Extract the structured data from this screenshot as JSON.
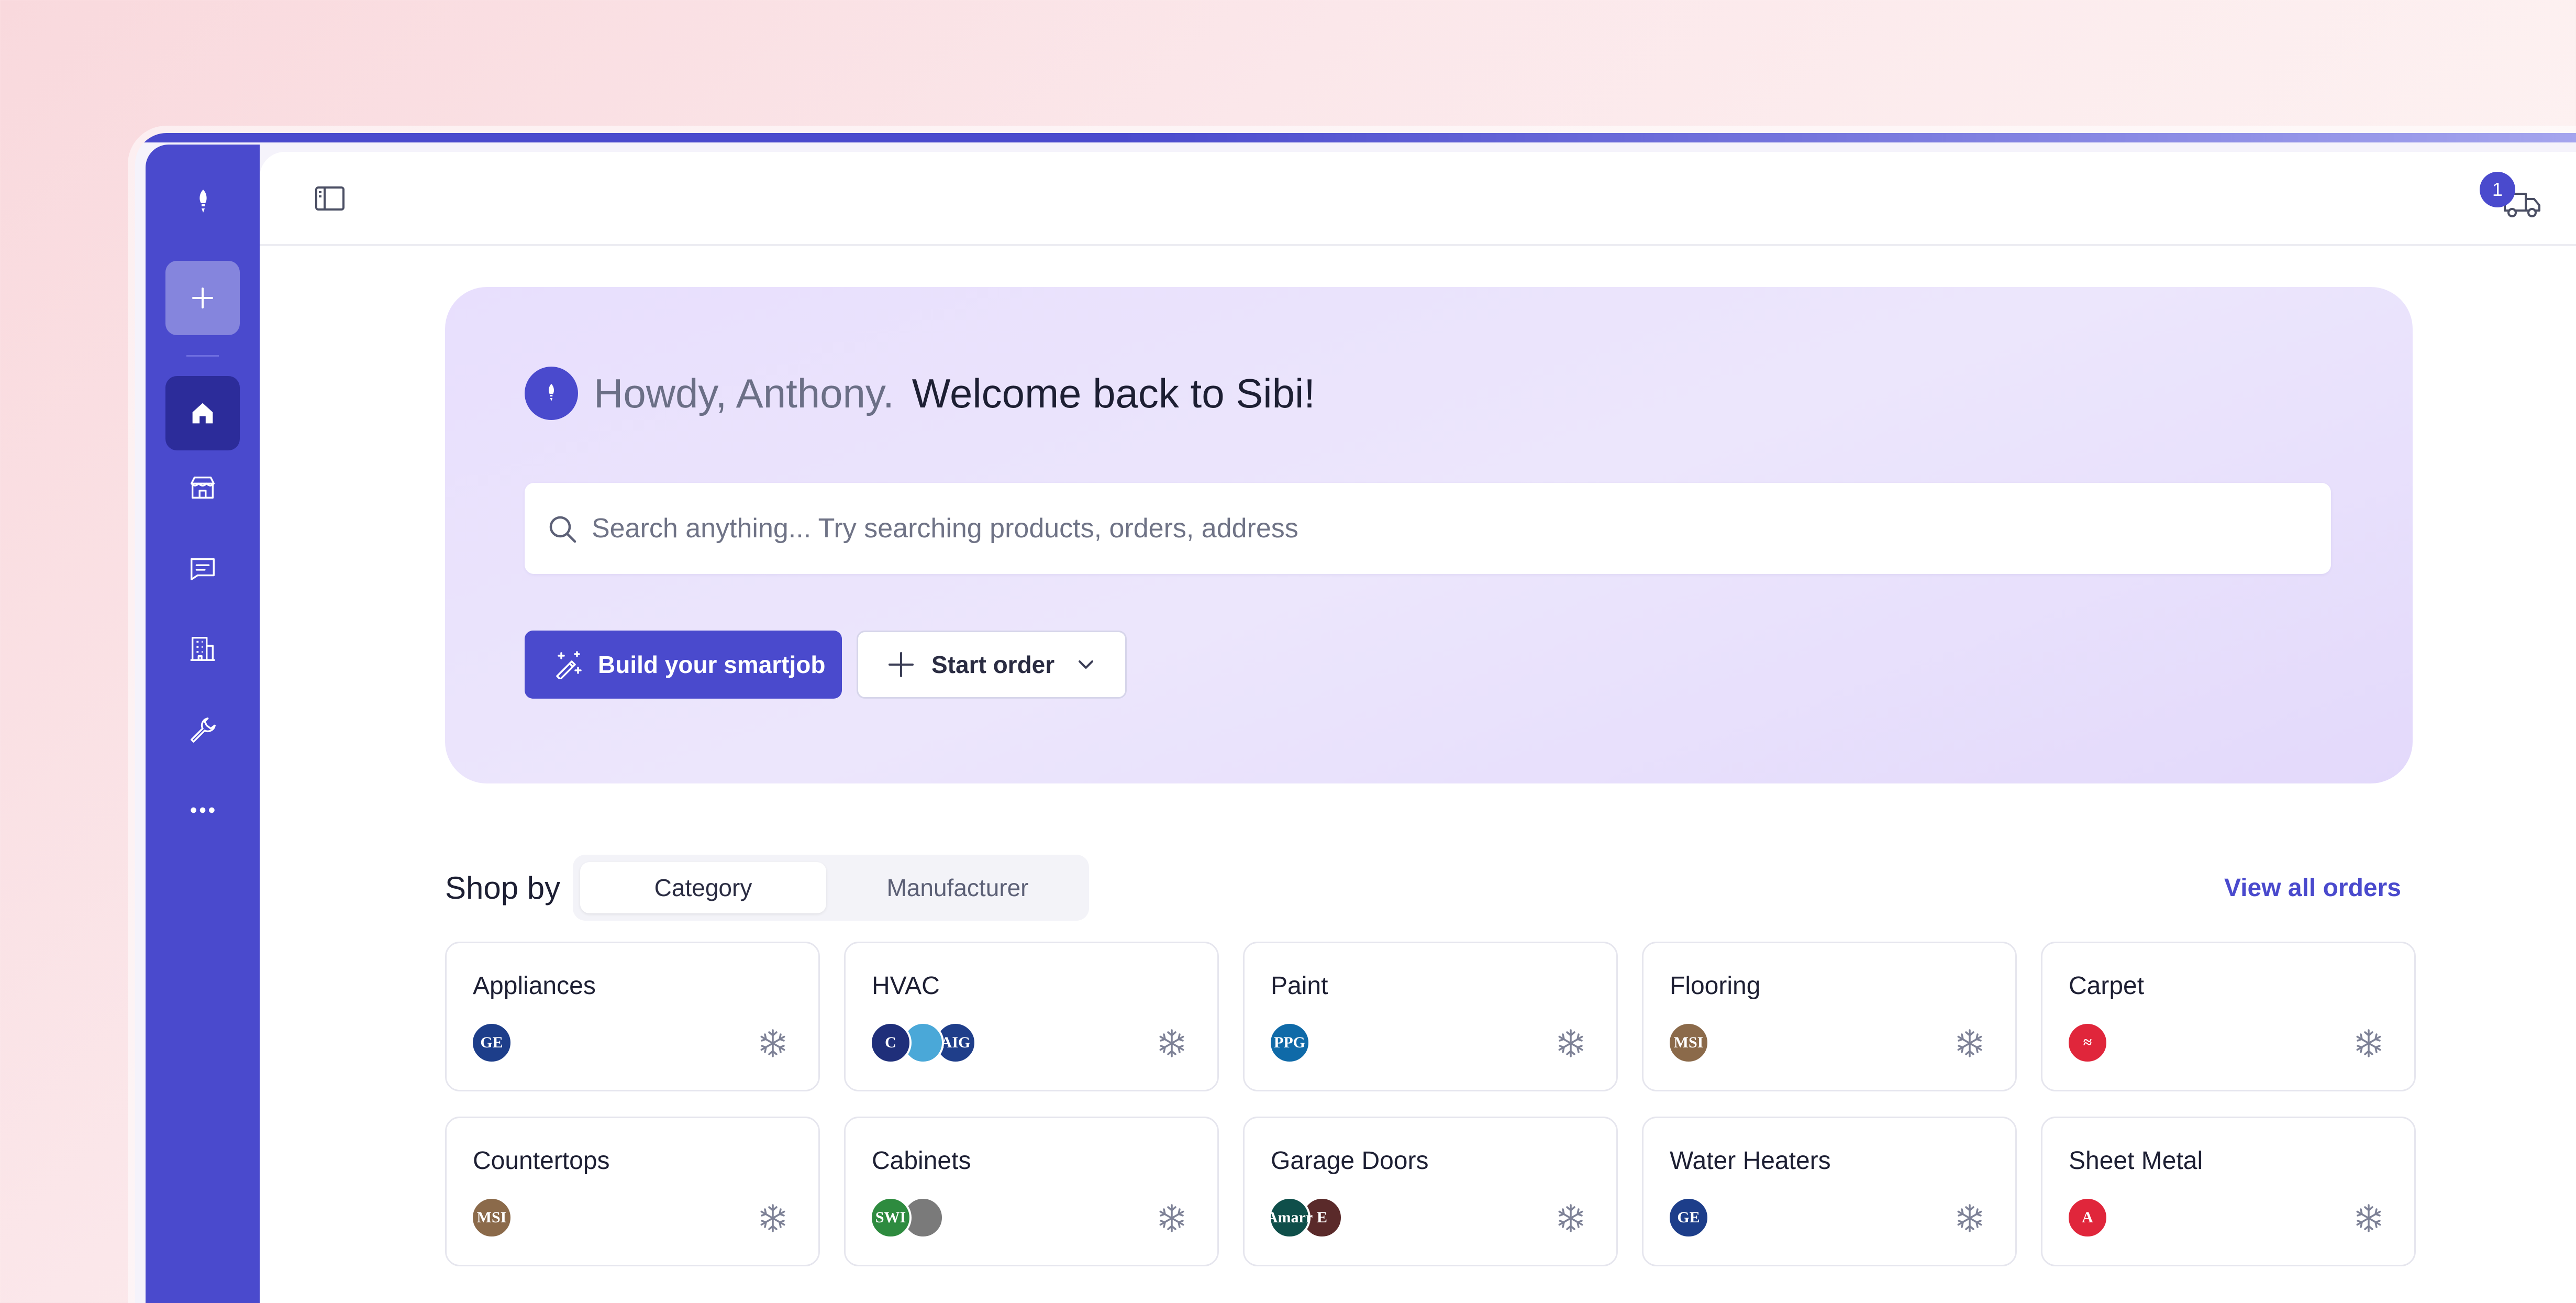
{
  "app": {
    "name": "Sibi"
  },
  "topbar": {
    "cart_count": "1"
  },
  "hero": {
    "greeting": "Howdy, Anthony.",
    "welcome": "Welcome back to Sibi!",
    "search_placeholder": "Search anything... Try searching products, orders, address",
    "build_label": "Build your smartjob",
    "start_label": "Start order"
  },
  "shop": {
    "label": "Shop by",
    "tabs": [
      "Category",
      "Manufacturer"
    ],
    "active_tab": "Category",
    "view_all": "View all orders",
    "categories": [
      {
        "name": "Appliances",
        "logos": [
          {
            "text": "GE",
            "color": "#1d3e8a"
          }
        ]
      },
      {
        "name": "HVAC",
        "logos": [
          {
            "text": "C",
            "color": "#1f2f7a"
          },
          {
            "text": "",
            "color": "#4aa8d8"
          },
          {
            "text": "AIG",
            "color": "#1f3e8a"
          }
        ]
      },
      {
        "name": "Paint",
        "logos": [
          {
            "text": "PPG",
            "color": "#0f6aa8"
          }
        ]
      },
      {
        "name": "Flooring",
        "logos": [
          {
            "text": "MSI",
            "color": "#8b6a4a"
          }
        ]
      },
      {
        "name": "Carpet",
        "logos": [
          {
            "text": "≈",
            "color": "#e0263b"
          }
        ]
      },
      {
        "name": "Countertops",
        "logos": [
          {
            "text": "MSI",
            "color": "#8b6a4a"
          }
        ]
      },
      {
        "name": "Cabinets",
        "logos": [
          {
            "text": "SWI",
            "color": "#2e8b3f"
          },
          {
            "text": "",
            "color": "#7a7a7a"
          }
        ]
      },
      {
        "name": "Garage Doors",
        "logos": [
          {
            "text": "Amarr",
            "color": "#0f4f4a"
          },
          {
            "text": "E",
            "color": "#5a2a2a"
          }
        ]
      },
      {
        "name": "Water Heaters",
        "logos": [
          {
            "text": "GE",
            "color": "#1d3e8a"
          }
        ]
      },
      {
        "name": "Sheet Metal",
        "logos": [
          {
            "text": "A",
            "color": "#e0263b"
          }
        ]
      }
    ]
  },
  "colors": {
    "accent": "#4a4acd",
    "sidebar": "#4a4acd",
    "active_nav": "#2c2c9a"
  },
  "icons": {
    "sidebar": [
      "add-icon",
      "home-icon",
      "store-icon",
      "receipt-icon",
      "building-icon",
      "wrench-icon",
      "more-icon"
    ],
    "card_action": "snowflake-icon"
  }
}
